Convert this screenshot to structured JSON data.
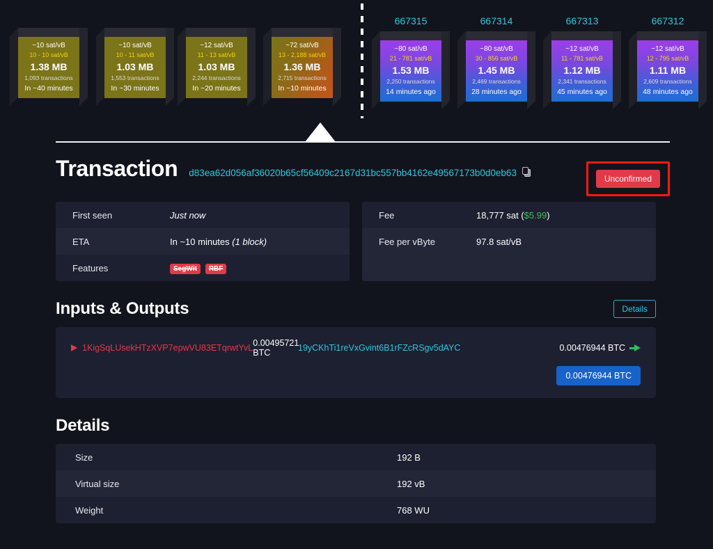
{
  "blockchain": {
    "divider_icon": "dashed-vertical-divider",
    "mempool_blocks": [
      {
        "median_fee": "~10 sat/vB",
        "fee_range": "10 - 10 sat/vB",
        "size": "1.38 MB",
        "transactions": "1,093 transactions",
        "eta": "In ~40 minutes",
        "hot": false
      },
      {
        "median_fee": "~10 sat/vB",
        "fee_range": "10 - 11 sat/vB",
        "size": "1.03 MB",
        "transactions": "1,553 transactions",
        "eta": "In ~30 minutes",
        "hot": false
      },
      {
        "median_fee": "~12 sat/vB",
        "fee_range": "11 - 13 sat/vB",
        "size": "1.03 MB",
        "transactions": "2,244 transactions",
        "eta": "In ~20 minutes",
        "hot": false
      },
      {
        "median_fee": "~72 sat/vB",
        "fee_range": "13 - 2,188 sat/vB",
        "size": "1.36 MB",
        "transactions": "2,715 transactions",
        "eta": "In ~10 minutes",
        "hot": true
      }
    ],
    "chain_blocks": [
      {
        "height": "667315",
        "median_fee": "~80 sat/vB",
        "fee_range": "21 - 781 sat/vB",
        "size": "1.53 MB",
        "transactions": "2,250 transactions",
        "age": "14 minutes ago"
      },
      {
        "height": "667314",
        "median_fee": "~80 sat/vB",
        "fee_range": "30 - 856 sat/vB",
        "size": "1.45 MB",
        "transactions": "2,469 transactions",
        "age": "28 minutes ago"
      },
      {
        "height": "667313",
        "median_fee": "~12 sat/vB",
        "fee_range": "11 - 781 sat/vB",
        "size": "1.12 MB",
        "transactions": "2,341 transactions",
        "age": "45 minutes ago"
      },
      {
        "height": "667312",
        "median_fee": "~12 sat/vB",
        "fee_range": "12 - 795 sat/vB",
        "size": "1.11 MB",
        "transactions": "2,609 transactions",
        "age": "48 minutes ago"
      }
    ]
  },
  "transaction": {
    "title": "Transaction",
    "txid": "d83ea62d056af36020b65cf56409c2167d31bc557bb4162e49567173b0d0eb63",
    "copy_icon": "clipboard-copy-icon",
    "status_badge": "Unconfirmed",
    "highlight_color": "#fb1a0f",
    "left_table": [
      {
        "key": "First seen",
        "value": "Just now",
        "italic": true
      },
      {
        "key": "ETA",
        "value_plain": "In ~10 minutes ",
        "value_italic": "(1 block)"
      },
      {
        "key": "Features",
        "badges": [
          "SegWit",
          "RBF"
        ]
      }
    ],
    "right_table": [
      {
        "key": "Fee",
        "value_plain": "18,777 sat (",
        "value_green": "$5.99",
        "value_tail": ")"
      },
      {
        "key": "Fee per vByte",
        "value": "97.8 sat/vB"
      }
    ]
  },
  "inputs_outputs": {
    "heading": "Inputs & Outputs",
    "details_button": "Details",
    "rows": [
      {
        "input_address": "1KigSqLUsekHTzXVP7epwVU83ETqrwtYvL",
        "input_amount": "0.00495721 BTC",
        "output_address": "19yCKhTi1reVxGvint6B1rFZcRSgv5dAYC",
        "output_amount": "0.00476944 BTC",
        "output_pill": "0.00476944 BTC"
      }
    ]
  },
  "details": {
    "heading": "Details",
    "rows": [
      {
        "key": "Size",
        "value": "192 B"
      },
      {
        "key": "Virtual size",
        "value": "192 vB"
      },
      {
        "key": "Weight",
        "value": "768 WU"
      }
    ]
  }
}
